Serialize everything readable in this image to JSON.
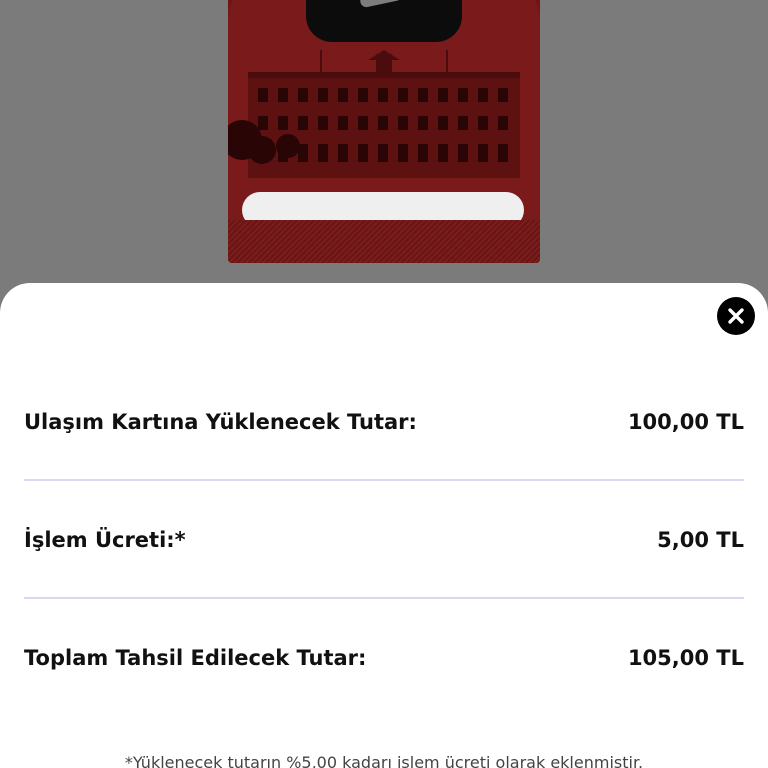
{
  "sheet": {
    "rows": [
      {
        "label": "Ulaşım Kartına Yüklenecek Tutar:",
        "value": "100,00 TL"
      },
      {
        "label": "İşlem Ücreti:*",
        "value": "5,00 TL"
      },
      {
        "label": "Toplam Tahsil Edilecek Tutar:",
        "value": "105,00 TL"
      }
    ],
    "footnote": "*Yüklenecek tutarın %5,00 kadarı işlem ücreti olarak eklenmiştir."
  },
  "icons": {
    "close": "close-icon"
  },
  "colors": {
    "overlay": "#7b7b7b",
    "card_red": "#7a1a1a",
    "divider": "#d6d9ef",
    "close_button": "#000000"
  }
}
